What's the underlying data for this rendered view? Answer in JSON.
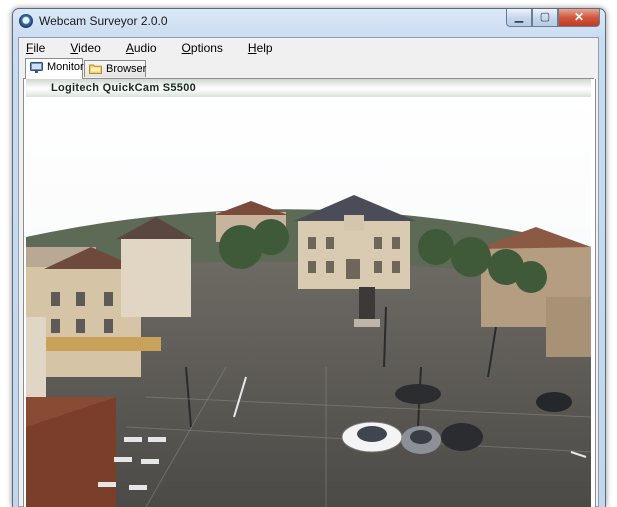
{
  "window": {
    "title": "Webcam Surveyor 2.0.0",
    "icons": {
      "app": "webcam-icon",
      "minimize": "minimize-icon",
      "maximize": "maximize-icon",
      "close": "close-icon"
    },
    "caption": {
      "minimize": "▁",
      "maximize": "▢",
      "close": "✕"
    }
  },
  "menu": [
    {
      "first": "F",
      "rest": "ile"
    },
    {
      "first": "V",
      "rest": "ideo"
    },
    {
      "first": "A",
      "rest": "udio"
    },
    {
      "first": "O",
      "rest": "ptions"
    },
    {
      "first": "H",
      "rest": "elp"
    }
  ],
  "tabs": [
    {
      "label": "Monitor",
      "icon": "monitor-icon",
      "active": true
    },
    {
      "label": "Browser",
      "icon": "folder-icon",
      "active": false
    }
  ],
  "camera": {
    "name": "Logitech QuickCam S5500"
  },
  "feed": {
    "description_icon": "webcam-feed-image"
  }
}
